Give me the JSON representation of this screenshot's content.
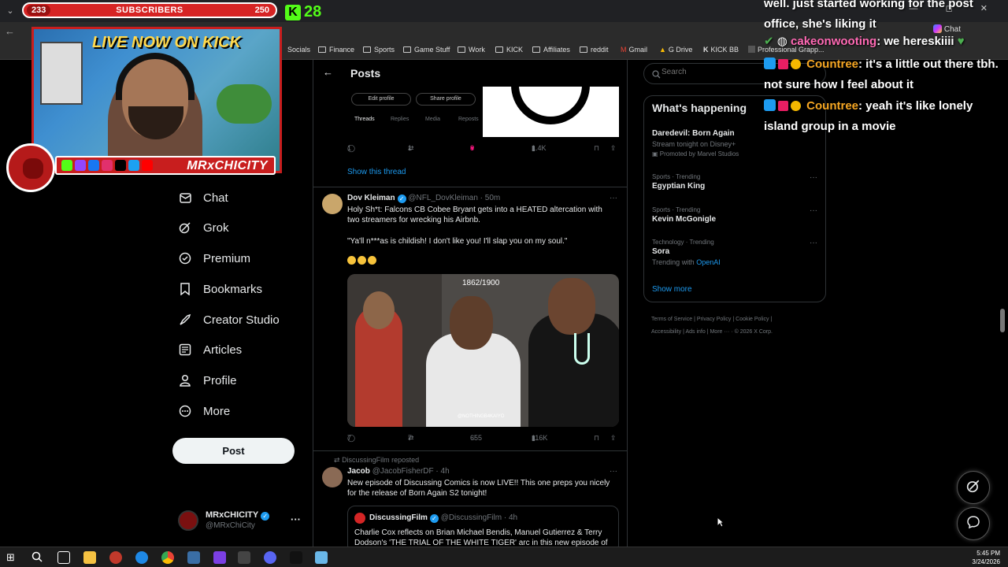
{
  "browser": {
    "win_controls": "— ◻ ✕",
    "bookmarks": [
      "Socials",
      "Finance",
      "Sports",
      "Game Stuff",
      "Work",
      "KICK",
      "Affiliates",
      "reddit",
      "Gmail",
      "G Drive",
      "KICK BB",
      "Professional Grapp..."
    ],
    "chat_tab": "Chat"
  },
  "overlay": {
    "subs_current": "233",
    "subs_label": "SUBSCRIBERS",
    "subs_goal": "250",
    "kick_count": "28",
    "cam_title": "LIVE NOW ON KICK",
    "streamer_name": "MRxCHICITY"
  },
  "nav": {
    "items": [
      {
        "label": "Chat",
        "icon": "chat-icon"
      },
      {
        "label": "Grok",
        "icon": "grok-icon"
      },
      {
        "label": "Premium",
        "icon": "premium-icon"
      },
      {
        "label": "Bookmarks",
        "icon": "bookmark-icon"
      },
      {
        "label": "Creator Studio",
        "icon": "creator-studio-icon"
      },
      {
        "label": "Articles",
        "icon": "articles-icon"
      },
      {
        "label": "Profile",
        "icon": "profile-icon"
      },
      {
        "label": "More",
        "icon": "more-icon"
      }
    ],
    "post_button": "Post",
    "account_name": "MRxCHICITY",
    "account_handle": "@MRxChiCity"
  },
  "posts": {
    "header": "Posts",
    "profile_card": {
      "edit_profile": "Edit profile",
      "share_profile": "Share profile",
      "tabs": [
        "Threads",
        "Replies",
        "Media",
        "Reposts"
      ]
    },
    "thread_post": {
      "replies": "1",
      "reposts": "1",
      "likes": "8",
      "views": "1.4K",
      "show_thread": "Show this thread"
    },
    "tweet1": {
      "name": "Dov Kleiman",
      "handle": "@NFL_DovKleiman · 50m",
      "text1": "Holy Sh*t: Falcons CB Cobee Bryant gets into a HEATED altercation with two streamers for wrecking his Airbnb.",
      "text2": "\"Ya'll n***as is childish! I don't like you! I'll slap you on my soul.\"",
      "video_counter": "1862/1900",
      "video_tag": "@NOTHINGB4KAIYO",
      "replies": "7",
      "reposts": "7",
      "likes": "655",
      "views": "116K"
    },
    "tweet2": {
      "repost_label": "DiscussingFilm reposted",
      "name": "Jacob",
      "handle": "@JacobFisherDF · 4h",
      "text": "New episode of Discussing Comics is now LIVE!! This one preps you nicely for the release of Born Again S2 tonight!",
      "quote_name": "DiscussingFilm",
      "quote_handle": "@DiscussingFilm · 4h",
      "quote_text": "Charlie Cox reflects on Brian Michael Bendis, Manuel Gutierrez & Terry Dodson's 'THE TRIAL OF THE WHITE TIGER' arc in this new episode of"
    }
  },
  "sidebar": {
    "search_placeholder": "Search",
    "happening_title": "What's happening",
    "trends": [
      {
        "meta": "",
        "name": "Daredevil: Born Again",
        "sub": "Stream tonight on Disney+",
        "promo": "Promoted by Marvel Studios"
      },
      {
        "meta": "Sports · Trending",
        "name": "Egyptian King",
        "sub": ""
      },
      {
        "meta": "Sports · Trending",
        "name": "Kevin McGonigle",
        "sub": ""
      },
      {
        "meta": "Technology · Trending",
        "name": "Sora",
        "sub_prefix": "Trending with",
        "sub_link": "OpenAI"
      }
    ],
    "show_more": "Show more",
    "footer": [
      "Terms of Service",
      "Privacy Policy",
      "Cookie Policy",
      "Accessibility",
      "Ads info",
      "More ···",
      "© 2026 X Corp."
    ]
  },
  "chat": {
    "line0": "well. just started working for the post office, she's liking it",
    "line1_user": "cakeonwooting",
    "line1_msg": ": we hereskiiii",
    "line2_user": "Countree",
    "line2_msg": ": it's a little out there tbh. not sure how I feel about it",
    "line3_user": "Countree",
    "line3_msg": ": yeah it's like lonely island group in a movie"
  },
  "taskbar": {
    "time": "5:45 PM",
    "date": "3/24/2026"
  },
  "colors": {
    "accent": "#1d9bf0",
    "like": "#f91880",
    "kick": "#53fc18",
    "overlay_red": "#c81e1e"
  }
}
